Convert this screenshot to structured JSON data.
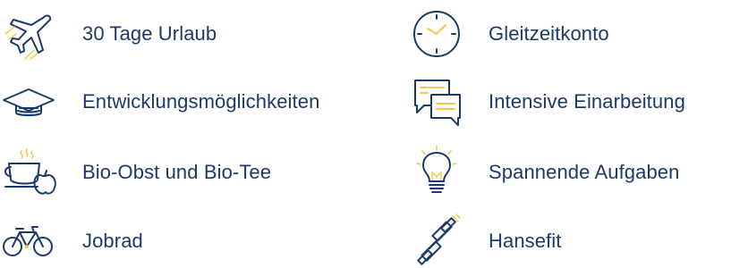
{
  "colors": {
    "text": "#1b3a6b",
    "icon_stroke": "#1b3a6b",
    "accent": "#f2c94c"
  },
  "benefits": [
    {
      "label": "30 Tage Urlaub",
      "icon": "airplane-icon"
    },
    {
      "label": "Entwicklungsmöglichkeiten",
      "icon": "graduation-cap-icon"
    },
    {
      "label": "Bio-Obst und Bio-Tee",
      "icon": "tea-cup-apple-icon"
    },
    {
      "label": "Jobrad",
      "icon": "bicycle-icon"
    },
    {
      "label": "Gleitzeitkonto",
      "icon": "clock-icon"
    },
    {
      "label": "Intensive Einarbeitung",
      "icon": "chat-bubbles-icon"
    },
    {
      "label": "Spannende Aufgaben",
      "icon": "light-bulb-icon"
    },
    {
      "label": "Hansefit",
      "icon": "dumbbell-icon"
    }
  ]
}
